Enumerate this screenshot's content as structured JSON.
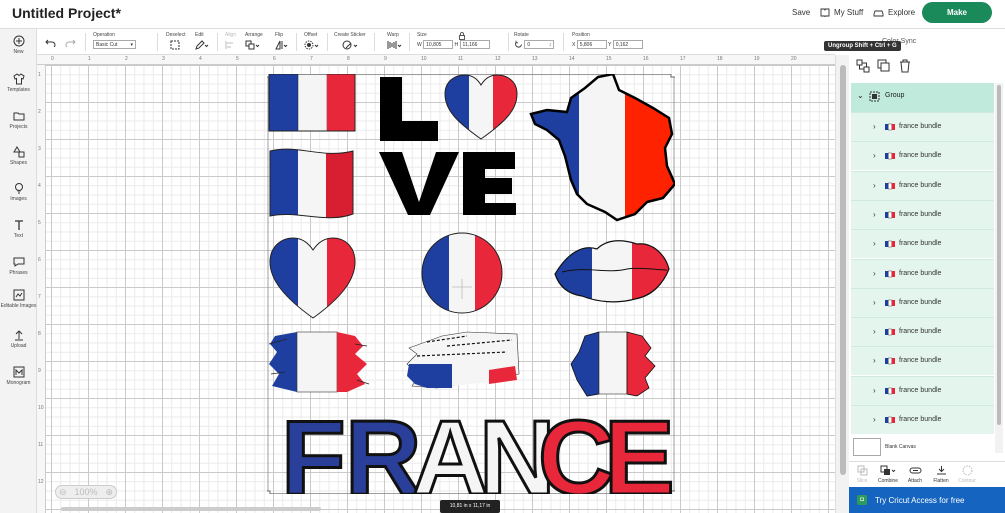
{
  "title": "Untitled Project*",
  "header": {
    "save": "Save",
    "my_stuff": "My Stuff",
    "explore": "Explore",
    "make": "Make"
  },
  "sidebar": [
    {
      "label": "New",
      "icon": "plus-icon"
    },
    {
      "label": "Templates",
      "icon": "shirt-icon"
    },
    {
      "label": "Projects",
      "icon": "folder-icon"
    },
    {
      "label": "Shapes",
      "icon": "shapes-icon"
    },
    {
      "label": "Images",
      "icon": "lightbulb-icon"
    },
    {
      "label": "Text",
      "icon": "text-icon"
    },
    {
      "label": "Phrases",
      "icon": "speech-bubble-icon"
    },
    {
      "label": "Editable Images",
      "icon": "editable-image-icon"
    },
    {
      "label": "Upload",
      "icon": "upload-icon"
    },
    {
      "label": "Monogram",
      "icon": "monogram-icon"
    }
  ],
  "toolbar": {
    "operation_label": "Operation",
    "operation_value": "Basic Cut",
    "deselect": "Deselect",
    "edit": "Edit",
    "align": "Align",
    "arrange": "Arrange",
    "flip": "Flip",
    "offset": "Offset",
    "create_sticker": "Create Sticker",
    "warp": "Warp",
    "size_label": "Size",
    "w_label": "W",
    "w_value": "10,805",
    "h_label": "H",
    "h_value": "11,166",
    "rotate_label": "Rotate",
    "rotate_value": "0",
    "position_label": "Position",
    "x_label": "X",
    "x_value": "5,806",
    "y_label": "Y",
    "y_value": "0,162"
  },
  "ruler": {
    "top": [
      "0",
      "1",
      "2",
      "3",
      "4",
      "5",
      "6",
      "7",
      "8",
      "9",
      "10",
      "11",
      "12",
      "13",
      "14",
      "15",
      "16",
      "17",
      "18",
      "19",
      "20"
    ],
    "left": [
      "1",
      "2",
      "3",
      "4",
      "5",
      "6",
      "7",
      "8",
      "9",
      "10",
      "11",
      "12"
    ]
  },
  "canvas": {
    "zoom": "100%",
    "size_badge": "10,81 in x 11,17 in",
    "love_text": [
      "L",
      "VE"
    ],
    "france_text": [
      "F",
      "R",
      "A",
      "N",
      "C",
      "E"
    ]
  },
  "colors": {
    "blue": "#1f3fa0",
    "white": "#f5f5f5",
    "red": "#e8283a",
    "black": "#000000",
    "accent": "#1a8a5a"
  },
  "layers": {
    "color_sync": "Color Sync",
    "tooltip": "Ungroup Shift + Ctrl + G",
    "group_label": "Group",
    "items": [
      "france bundle",
      "france bundle",
      "france bundle",
      "france bundle",
      "france bundle",
      "france bundle",
      "france bundle",
      "france bundle",
      "france bundle",
      "france bundle",
      "france bundle"
    ],
    "blank_canvas": "Blank Canvas",
    "actions": [
      "Slice",
      "Combine",
      "Attach",
      "Flatten",
      "Contour"
    ],
    "cta": "Try Cricut Access for free"
  }
}
